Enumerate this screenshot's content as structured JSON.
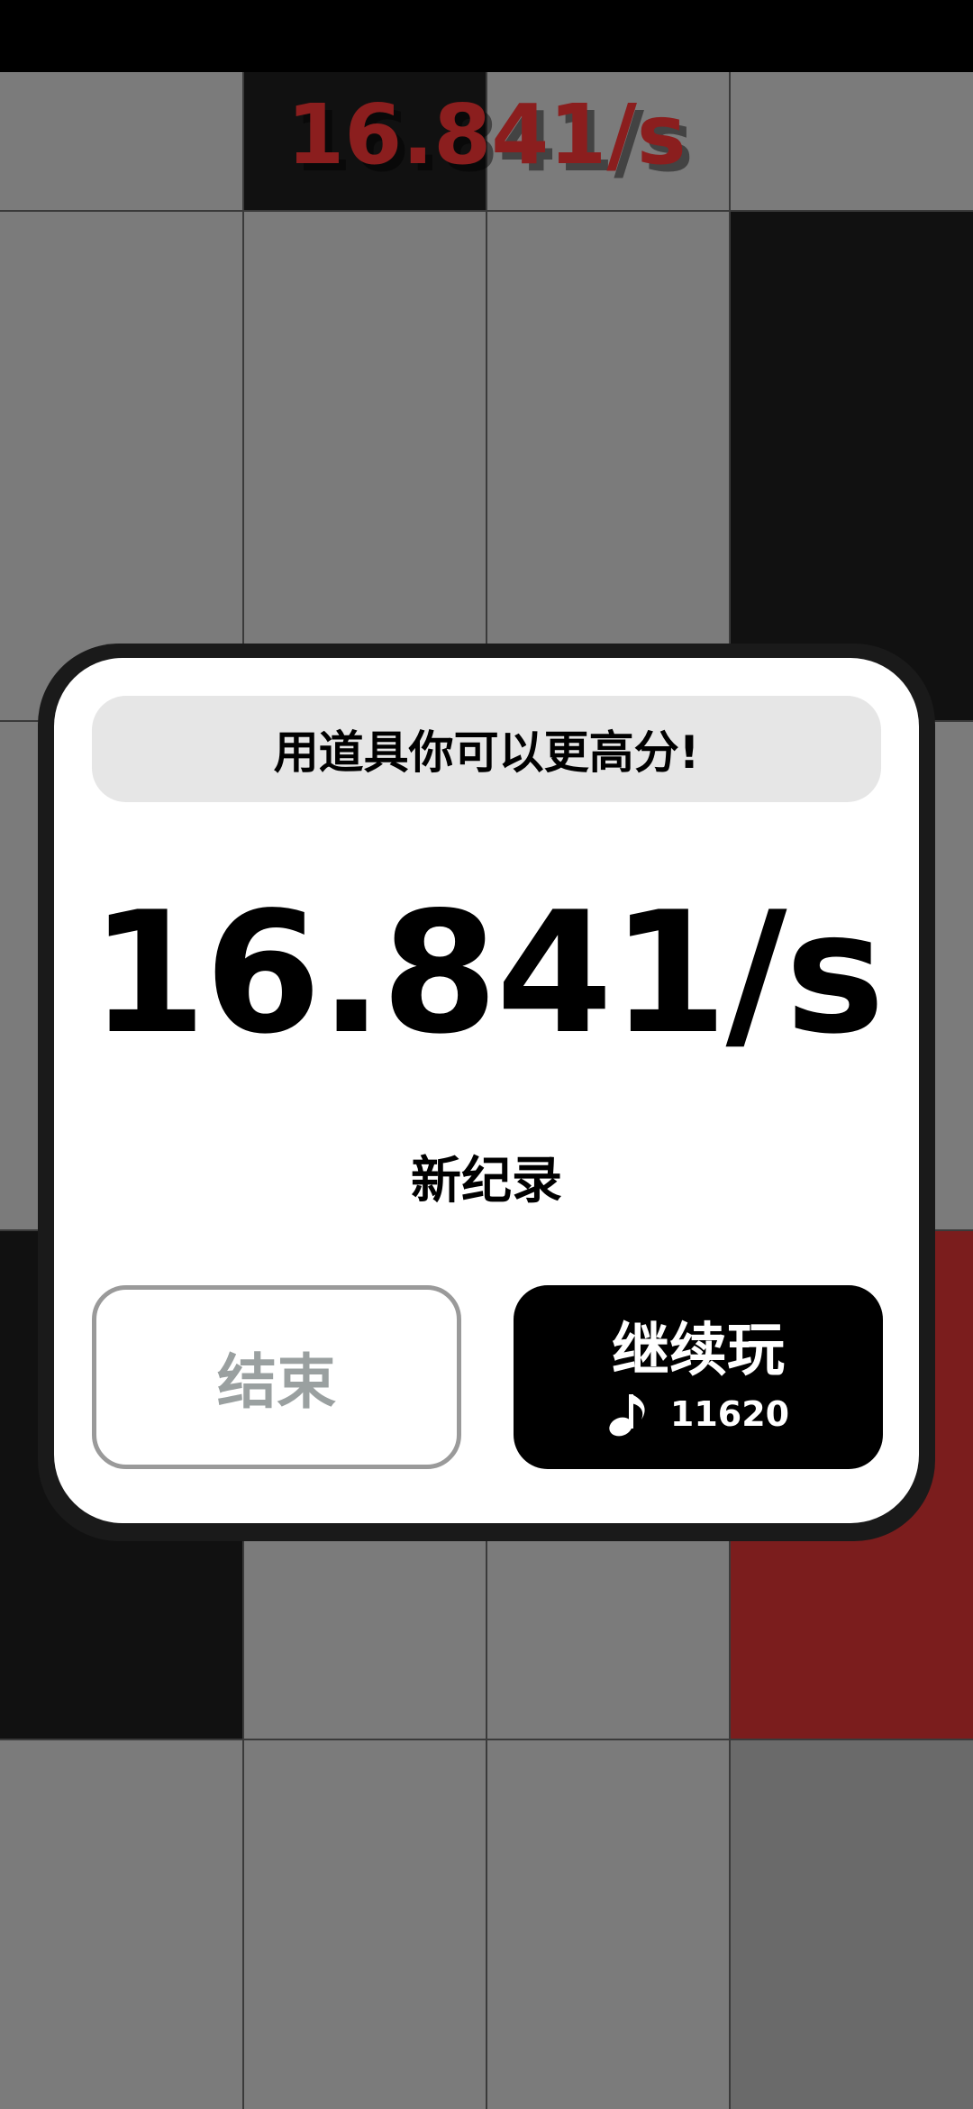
{
  "top_score": "16.841/s",
  "dialog": {
    "tip": "用道具你可以更高分!",
    "score": "16.841/s",
    "new_record": "新纪录",
    "end_label": "结束",
    "continue_label": "继续玩",
    "continue_cost": "11620",
    "cost_icon": "music-note-icon"
  },
  "colors": {
    "board_gray": "#7b7b7b",
    "black_tile": "#111111",
    "red_tile": "#7b1d1d",
    "score_red": "#8b1e1e"
  }
}
